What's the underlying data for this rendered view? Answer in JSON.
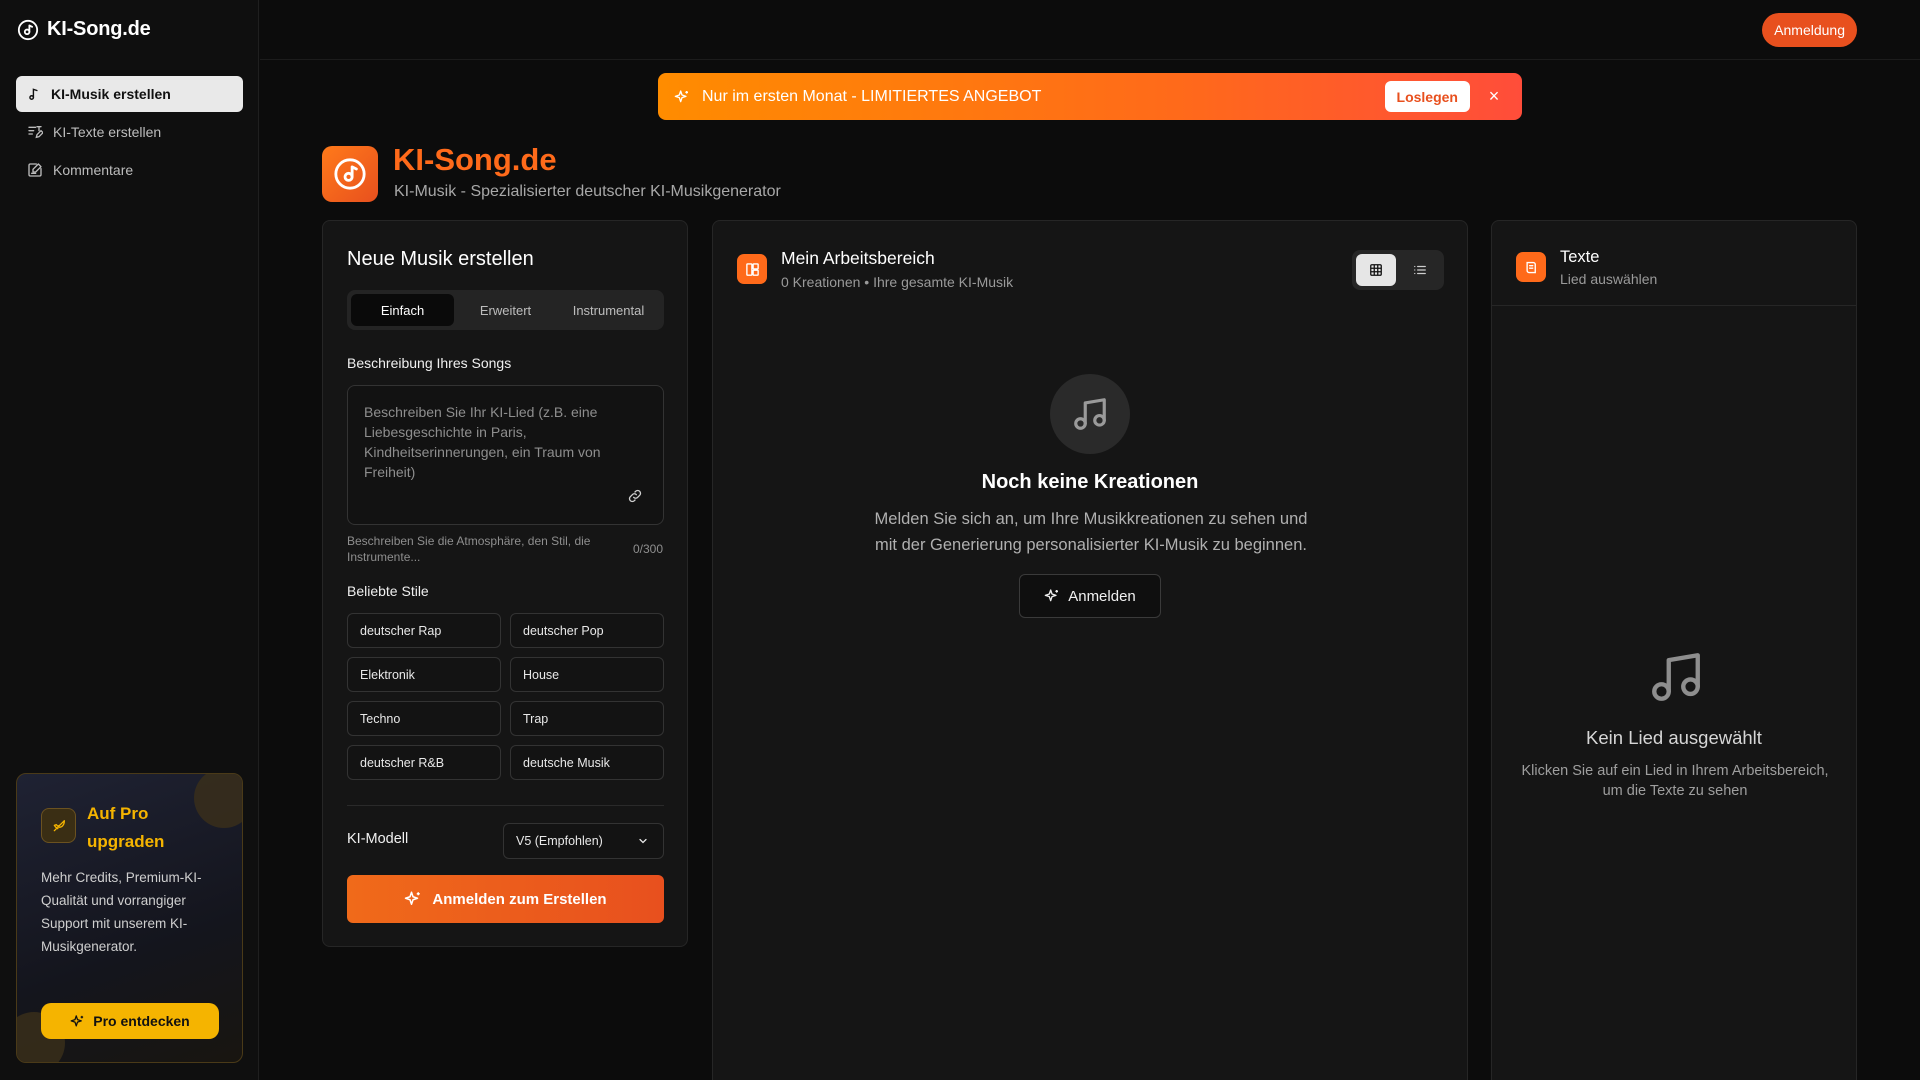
{
  "brand": {
    "name": "KI-Song.de"
  },
  "sidebar": {
    "items": [
      {
        "label": "KI-Musik erstellen",
        "icon": "music-note-icon",
        "active": true
      },
      {
        "label": "KI-Texte erstellen",
        "icon": "edit-lyrics-icon",
        "active": false
      },
      {
        "label": "Kommentare",
        "icon": "comment-edit-icon",
        "active": false
      }
    ],
    "pro": {
      "title": "Auf Pro upgraden",
      "description": "Mehr Credits, Premium-KI-Qualität und vorrangiger Support mit unserem KI-Musikgenerator.",
      "button": "Pro entdecken",
      "accent": "#f5b400"
    }
  },
  "topbar": {
    "login": "Anmeldung"
  },
  "promo": {
    "text": "Nur im ersten Monat - LIMITIERTES ANGEBOT",
    "cta": "Loslegen",
    "close": "×"
  },
  "header": {
    "title": "KI-Song.de",
    "subtitle": "KI-Musik - Spezialisierter deutscher KI-Musikgenerator",
    "accent": "#ff6a1a"
  },
  "create": {
    "title": "Neue Musik erstellen",
    "tabs": [
      {
        "label": "Einfach",
        "active": true
      },
      {
        "label": "Erweitert",
        "active": false
      },
      {
        "label": "Instrumental",
        "active": false
      }
    ],
    "description_label": "Beschreibung Ihres Songs",
    "description_placeholder": "Beschreiben Sie Ihr KI-Lied (z.B. eine Liebesgeschichte in Paris, Kindheitserinnerungen, ein Traum von Freiheit)",
    "hint": "Beschreiben Sie die Atmosphäre, den Stil, die Instrumente...",
    "char_count": "0/300",
    "styles_label": "Beliebte Stile",
    "styles": [
      "deutscher Rap",
      "deutscher Pop",
      "Elektronik",
      "House",
      "Techno",
      "Trap",
      "deutscher R&B",
      "deutsche Musik"
    ],
    "model_label": "KI-Modell",
    "model_value": "V5 (Empfohlen)",
    "submit": "Anmelden zum Erstellen"
  },
  "workspace": {
    "title": "Mein Arbeitsbereich",
    "subtitle": "0 Kreationen • Ihre gesamte KI-Musik",
    "empty_title": "Noch keine Kreationen",
    "empty_desc": "Melden Sie sich an, um Ihre Musikkreationen zu sehen und mit der Generierung personalisierter KI-Musik zu beginnen.",
    "empty_button": "Anmelden"
  },
  "texts": {
    "title": "Texte",
    "subtitle": "Lied auswählen",
    "empty_title": "Kein Lied ausgewählt",
    "empty_desc": "Klicken Sie auf ein Lied in Ihrem Arbeitsbereich, um die Texte zu sehen"
  }
}
